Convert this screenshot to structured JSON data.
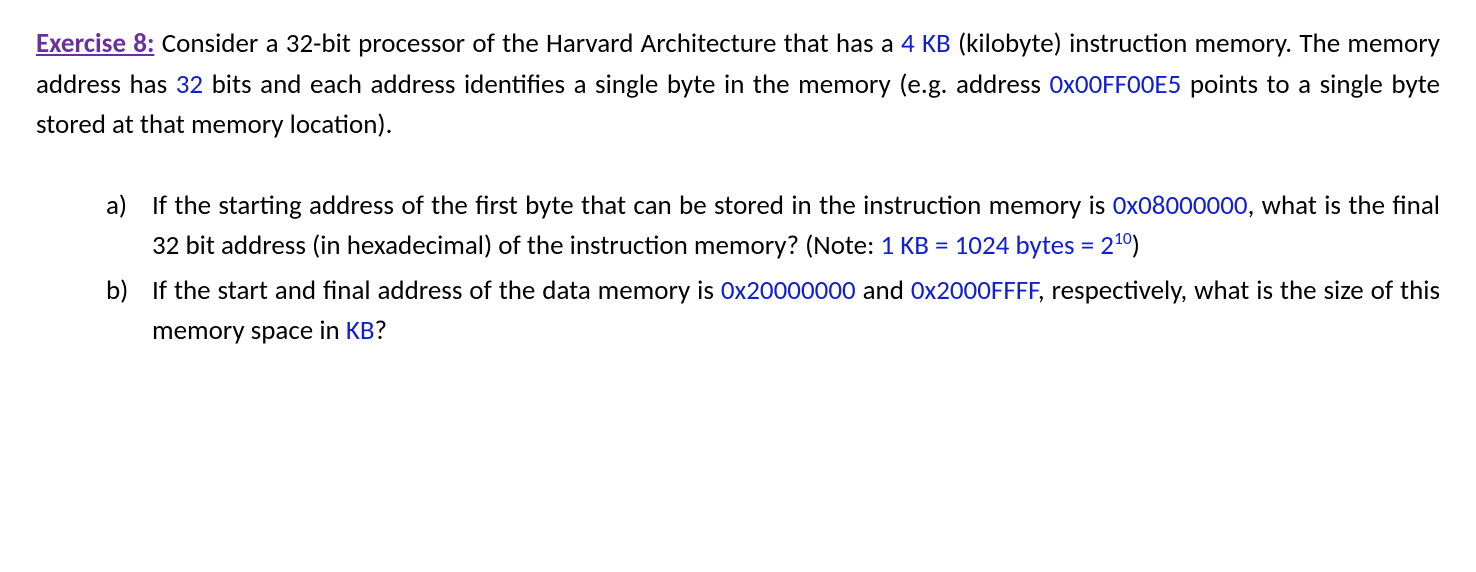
{
  "intro": {
    "label": "Exercise 8:",
    "t1": " Consider a 32-bit processor of the Harvard Architecture that has a ",
    "v1": "4 KB",
    "t2": " (kilobyte) instruction memory. The memory address has ",
    "v2": "32",
    "t3": " bits and each address identifies a single byte in the memory (e.g. address ",
    "v3": "0x00FF00E5",
    "t4": " points to a single byte stored at that memory location)."
  },
  "a": {
    "marker": "a)",
    "t1": "If the starting address of the first byte that can be stored in the instruction memory is ",
    "v1": "0x08000000",
    "t2": ", what is the final 32 bit address (in hexadecimal) of the instruction memory? (Note: ",
    "v2a": "1 KB = 1024 bytes = 2",
    "v2exp": "10",
    "t3": ")"
  },
  "b": {
    "marker": "b)",
    "t1": "If the start and final address of the data memory is ",
    "v1": "0x20000000",
    "t2": " and ",
    "v2": "0x2000FFFF",
    "t3": ", respectively, what is the size of this memory space in ",
    "v3": "KB",
    "t4": "?"
  }
}
